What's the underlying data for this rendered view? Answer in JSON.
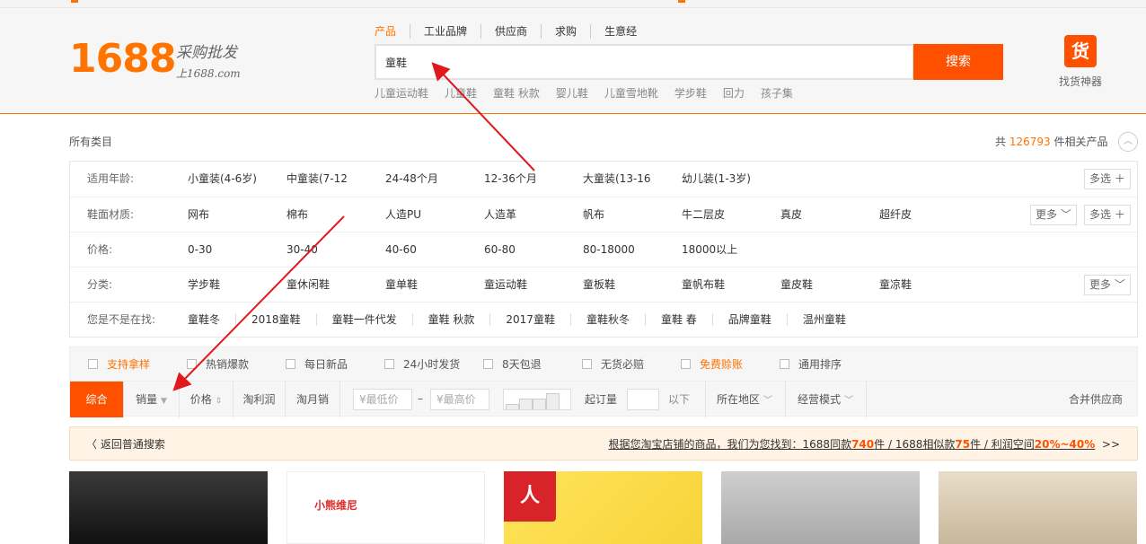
{
  "logo": {
    "number": "1688",
    "tagline": "采购批发",
    "sub": "上1688.com"
  },
  "search": {
    "tabs": [
      "产品",
      "工业品牌",
      "供应商",
      "求购",
      "生意经"
    ],
    "query": "童鞋",
    "button": "搜索",
    "hotwords": [
      "儿童运动鞋",
      "儿童鞋",
      "童鞋 秋款",
      "婴儿鞋",
      "儿童雪地靴",
      "学步鞋",
      "回力",
      "孩子集"
    ]
  },
  "finder": {
    "icon_char": "货",
    "label": "找货神器"
  },
  "category": {
    "crumb": "所有类目",
    "total_prefix": "共",
    "total_count": "126793",
    "total_suffix": "件相关产品"
  },
  "filters": [
    {
      "label": "适用年龄:",
      "values": [
        "小童装(4-6岁)",
        "中童装(7-12",
        "24-48个月",
        "12-36个月",
        "大童装(13-16",
        "幼儿装(1-3岁)"
      ],
      "multi": "多选",
      "more": ""
    },
    {
      "label": "鞋面材质:",
      "values": [
        "网布",
        "棉布",
        "人造PU",
        "人造革",
        "帆布",
        "牛二层皮",
        "真皮",
        "超纤皮"
      ],
      "multi": "多选",
      "more": "更多"
    },
    {
      "label": "价格:",
      "values": [
        "0-30",
        "30-40",
        "40-60",
        "60-80",
        "80-18000",
        "18000以上"
      ],
      "multi": "",
      "more": ""
    },
    {
      "label": "分类:",
      "values": [
        "学步鞋",
        "童休闲鞋",
        "童单鞋",
        "童运动鞋",
        "童板鞋",
        "童帆布鞋",
        "童皮鞋",
        "童凉鞋"
      ],
      "multi": "",
      "more": "更多"
    },
    {
      "label": "您是不是在找:",
      "values": [
        "童鞋冬",
        "2018童鞋",
        "童鞋一件代发",
        "童鞋 秋款",
        "2017童鞋",
        "童鞋秋冬",
        "童鞋 春",
        "品牌童鞋",
        "温州童鞋"
      ],
      "multi": "",
      "more": ""
    }
  ],
  "options": [
    {
      "label": "支持拿样",
      "highlight": true
    },
    {
      "label": "热销爆款",
      "highlight": false
    },
    {
      "label": "每日新品",
      "highlight": false
    },
    {
      "label": "24小时发货",
      "highlight": false
    },
    {
      "label": "8天包退",
      "highlight": false
    },
    {
      "label": "无货必赔",
      "highlight": false
    },
    {
      "label": "免费赊账",
      "highlight": true
    },
    {
      "label": "通用排序",
      "highlight": false
    }
  ],
  "sort": {
    "comprehensive": "综合",
    "sales": "销量",
    "price": "价格",
    "profit": "淘利润",
    "monthly": "淘月销",
    "min_price_ph": "¥最低价",
    "max_price_ph": "¥最高价",
    "dash": "–",
    "min_qty": "起订量",
    "below": "以下",
    "region": "所在地区",
    "mode": "经营模式",
    "merge": "合并供应商"
  },
  "notice": {
    "back": "返回普通搜索",
    "text1": "根据您淘宝店铺的商品，我们为您找到：1688同款",
    "count1": "740",
    "text2": "件 / 1688相似款",
    "count2": "75",
    "text3": "件 / 利润空间",
    "range": "20%~40%",
    "more": ">>"
  },
  "products": [
    {
      "alt": "product-1"
    },
    {
      "alt": "product-2",
      "brand": "小熊维尼"
    },
    {
      "alt": "product-3",
      "brand": "人本"
    },
    {
      "alt": "product-4"
    },
    {
      "alt": "product-5"
    }
  ],
  "colors": {
    "accent": "#ff7300",
    "button": "#ff5000",
    "arrow": "#e0191c"
  }
}
